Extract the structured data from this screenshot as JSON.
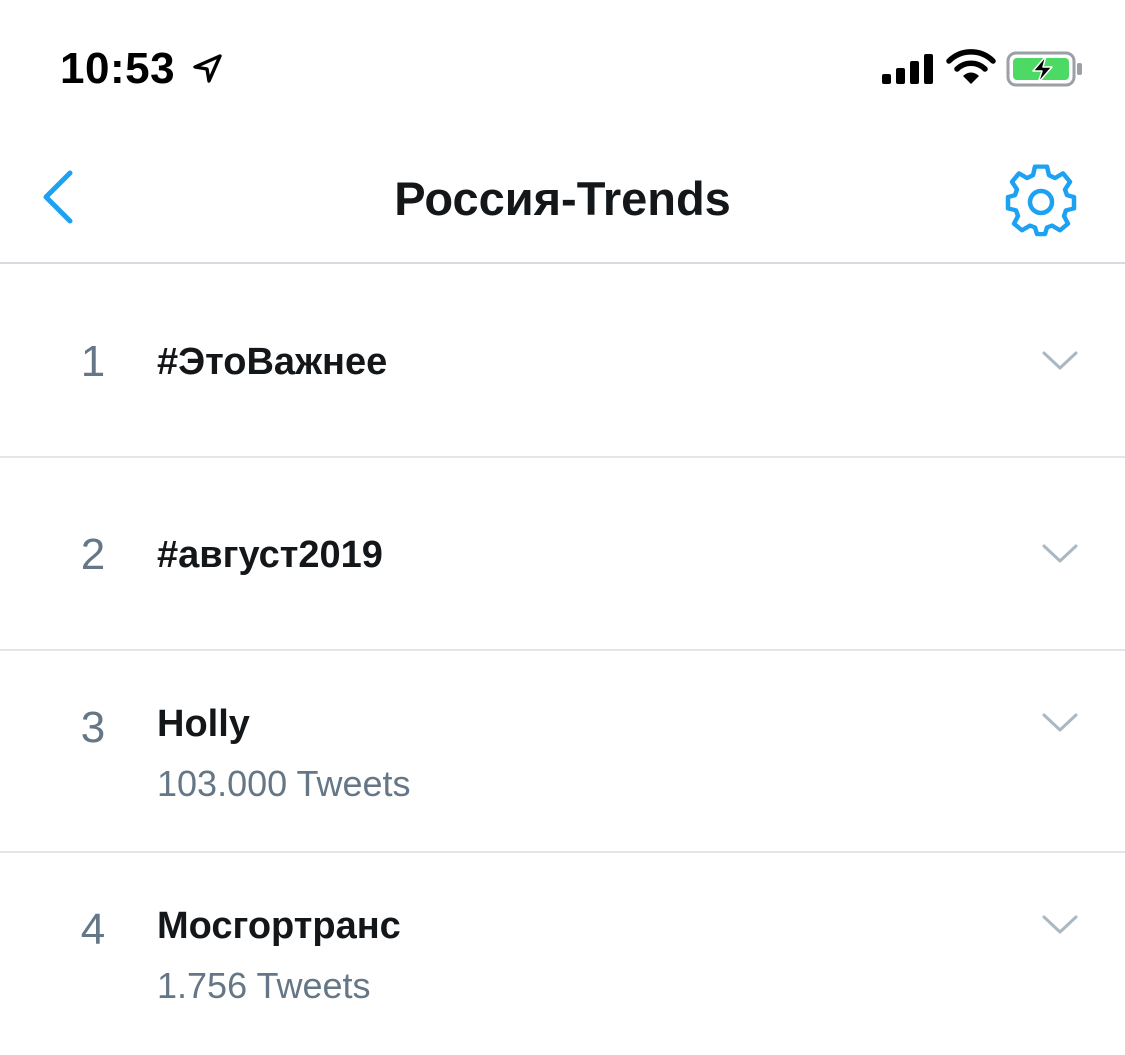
{
  "status_bar": {
    "time": "10:53",
    "icons": [
      "location-arrow-icon",
      "cellular-signal-icon",
      "wifi-icon",
      "battery-charging-icon"
    ]
  },
  "nav": {
    "title": "Россия-Trends",
    "back_icon": "chevron-left-icon",
    "settings_icon": "gear-icon"
  },
  "colors": {
    "accent": "#1da1f2",
    "text_primary": "#14171a",
    "text_secondary": "#657786",
    "divider": "#e1e6ea",
    "battery_green": "#4cd964"
  },
  "trends": [
    {
      "rank": "1",
      "name": "#ЭтоВажнее",
      "count": ""
    },
    {
      "rank": "2",
      "name": "#август2019",
      "count": ""
    },
    {
      "rank": "3",
      "name": "Holly",
      "count": "103.000 Tweets"
    },
    {
      "rank": "4",
      "name": "Мосгортранс",
      "count": "1.756 Tweets"
    }
  ]
}
